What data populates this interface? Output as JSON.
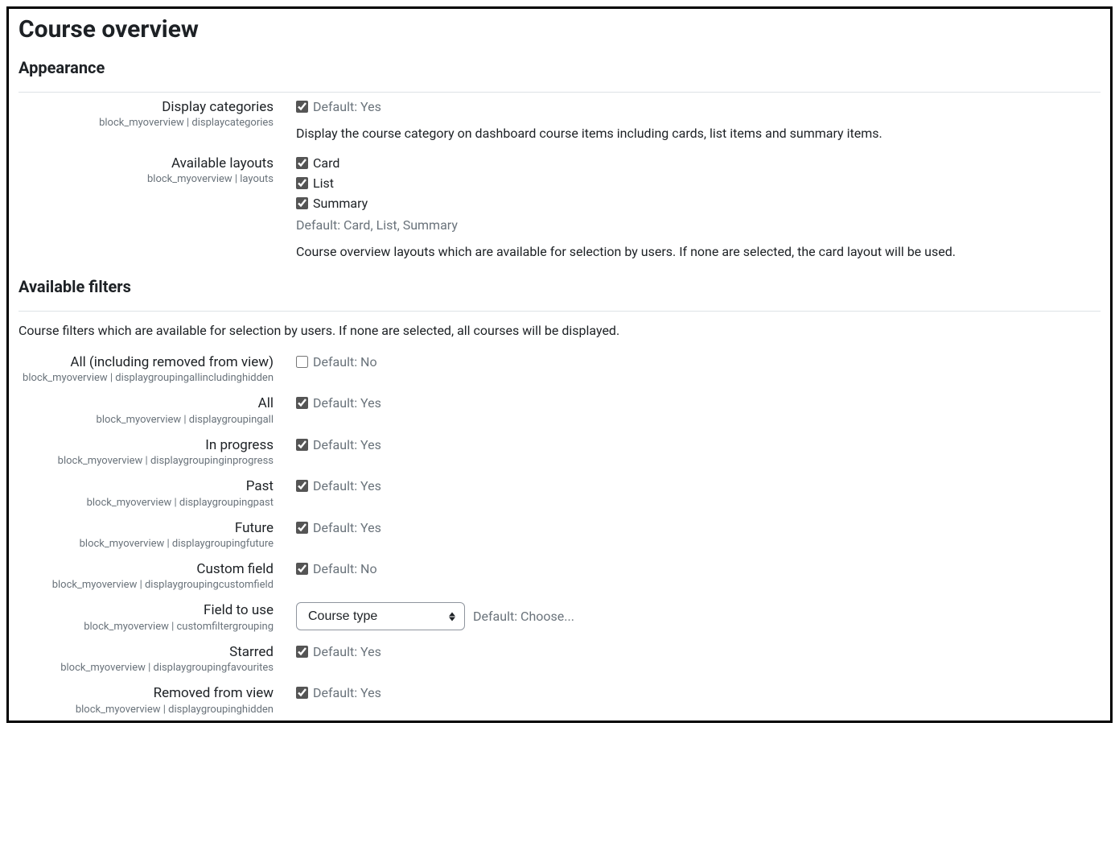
{
  "page": {
    "title": "Course overview"
  },
  "appearance": {
    "heading": "Appearance",
    "display_categories": {
      "label": "Display categories",
      "sub": "block_myoverview | displaycategories",
      "default_text": "Default: Yes",
      "desc": "Display the course category on dashboard course items including cards, list items and summary items."
    },
    "layouts": {
      "label": "Available layouts",
      "sub": "block_myoverview | layouts",
      "card": "Card",
      "list": "List",
      "summary": "Summary",
      "default_text": "Default: Card, List, Summary",
      "desc": "Course overview layouts which are available for selection by users. If none are selected, the card layout will be used."
    }
  },
  "filters": {
    "heading": "Available filters",
    "desc": "Course filters which are available for selection by users. If none are selected, all courses will be displayed.",
    "all_hidden": {
      "label": "All (including removed from view)",
      "sub": "block_myoverview | displaygroupingallincludinghidden",
      "default_text": "Default: No"
    },
    "all": {
      "label": "All",
      "sub": "block_myoverview | displaygroupingall",
      "default_text": "Default: Yes"
    },
    "inprogress": {
      "label": "In progress",
      "sub": "block_myoverview | displaygroupinginprogress",
      "default_text": "Default: Yes"
    },
    "past": {
      "label": "Past",
      "sub": "block_myoverview | displaygroupingpast",
      "default_text": "Default: Yes"
    },
    "future": {
      "label": "Future",
      "sub": "block_myoverview | displaygroupingfuture",
      "default_text": "Default: Yes"
    },
    "customfield": {
      "label": "Custom field",
      "sub": "block_myoverview | displaygroupingcustomfield",
      "default_text": "Default: No"
    },
    "field_to_use": {
      "label": "Field to use",
      "sub": "block_myoverview | customfiltergrouping",
      "selected": "Course type",
      "default_text": "Default: Choose..."
    },
    "starred": {
      "label": "Starred",
      "sub": "block_myoverview | displaygroupingfavourites",
      "default_text": "Default: Yes"
    },
    "removed": {
      "label": "Removed from view",
      "sub": "block_myoverview | displaygroupinghidden",
      "default_text": "Default: Yes"
    }
  }
}
